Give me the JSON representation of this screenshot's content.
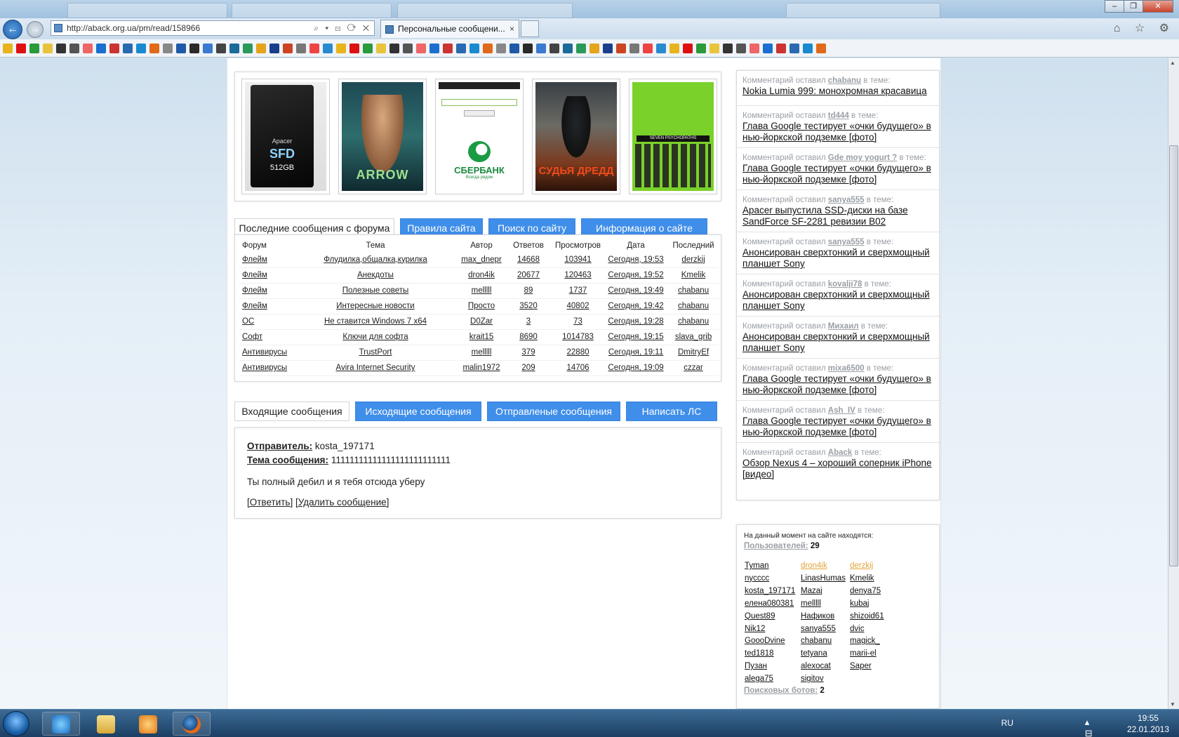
{
  "browser": {
    "url": "http://aback.org.ua/pm/read/158966",
    "tab_title": "Персональные сообщени...",
    "back_label": "←",
    "forward_label": "→",
    "tab_close": "×",
    "addr_tools": "⌕ ▾ ⊡ ⟳ ✕",
    "right_icons": "⌂ ☆ ⚙",
    "window_buttons": {
      "minimize": "–",
      "maximize": "❐",
      "close": "✕"
    }
  },
  "promo_images": [
    {
      "name": "apacer-ssd",
      "brand": "Apacer",
      "model": "SFD",
      "capacity": "512GB"
    },
    {
      "name": "arrow-series",
      "title": "ARROW"
    },
    {
      "name": "sberbank-login",
      "brand": "СБЕРБАНК",
      "slogan": "Всегда рядом"
    },
    {
      "name": "dredd-movie",
      "title": "СУДЬЯ ДРЕДД"
    },
    {
      "name": "seven-psychopaths",
      "title": "SEVEN PSYCHOPATHS"
    }
  ],
  "forum_tabs": {
    "active": "Последние сообщения с форума",
    "rules": "Правила сайта",
    "search": "Поиск по сайту",
    "info": "Информация о сайте"
  },
  "forum_table": {
    "headers": [
      "Форум",
      "Тема",
      "Автор",
      "Ответов",
      "Просмотров",
      "Дата",
      "Последний"
    ],
    "rows": [
      [
        "Флейм",
        "Флудилка,общалка,курилка",
        "max_dnepr",
        "14668",
        "103941",
        "Сегодня, 19:53",
        "derzkij"
      ],
      [
        "Флейм",
        "Анекдоты",
        "dron4ik",
        "20677",
        "120463",
        "Сегодня, 19:52",
        "Kmelik"
      ],
      [
        "Флейм",
        "Полезные советы",
        "melllll",
        "89",
        "1737",
        "Сегодня, 19:49",
        "chabanu"
      ],
      [
        "Флейм",
        "Интересные новости",
        "Просто",
        "3520",
        "40802",
        "Сегодня, 19:42",
        "chabanu"
      ],
      [
        "ОС",
        "Не ставится Windows 7 x64",
        "D0Zar",
        "3",
        "73",
        "Сегодня, 19:28",
        "chabanu"
      ],
      [
        "Софт",
        "Ключи для софта",
        "krait15",
        "8690",
        "1014783",
        "Сегодня, 19:15",
        "slava_grib"
      ],
      [
        "Антивирусы",
        "TrustPort",
        "melllll",
        "379",
        "22880",
        "Сегодня, 19:11",
        "DmitryEf"
      ],
      [
        "Антивирусы",
        "Avira Internet Security",
        "malin1972",
        "209",
        "14706",
        "Сегодня, 19:09",
        "czzar"
      ]
    ]
  },
  "pm_tabs": {
    "inbox": "Входящие сообщения",
    "outbox": "Исходящие сообщения",
    "sent": "Отправленые сообщения",
    "write": "Написать ЛС"
  },
  "message": {
    "sender_label": "Отправитель:",
    "sender": "kosta_197171",
    "subject_label": "Тема сообщения:",
    "subject": "11111111111111111111111111",
    "body": "Ты полный дебил и я тебя отсюда уберу",
    "reply": "[Ответить]",
    "delete": "[Удалить сообщение]"
  },
  "comments": {
    "prefix": "Комментарий оставил",
    "suffix": "в теме:",
    "items": [
      {
        "user": "chabanu",
        "title": "Nokia Lumia 999: монохромная красавица"
      },
      {
        "user": "td444",
        "title": "Глава Google тестирует «очки будущего» в нью-йоркской подземке [фото]"
      },
      {
        "user": "Gde moy yogurt ?",
        "title": "Глава Google тестирует «очки будущего» в нью-йоркской подземке [фото]"
      },
      {
        "user": "sanya555",
        "title": "Apacer выпустила SSD-диски на базе SandForce SF-2281 ревизии B02"
      },
      {
        "user": "sanya555",
        "title": "Анонсирован сверхтонкий и сверхмощный планшет Sony"
      },
      {
        "user": "kovalji78",
        "title": "Анонсирован сверхтонкий и сверхмощный планшет Sony"
      },
      {
        "user": "Михаил",
        "title": "Анонсирован сверхтонкий и сверхмощный планшет Sony"
      },
      {
        "user": "mixa6500",
        "title": "Глава Google тестирует «очки будущего» в нью-йоркской подземке [фото]"
      },
      {
        "user": "Ash_IV",
        "title": "Глава Google тестирует «очки будущего» в нью-йоркской подземке [фото]"
      },
      {
        "user": "Aback",
        "title": "Обзор Nexus 4 – хороший соперник iPhone [видео]"
      }
    ]
  },
  "online": {
    "header": "На данный момент на сайте находятся:",
    "users_label": "Пользователей:",
    "users_count": "29",
    "users": [
      {
        "name": "Tyman",
        "highlight": false
      },
      {
        "name": "dron4ik",
        "highlight": true
      },
      {
        "name": "derzkij",
        "highlight": true
      },
      {
        "name": "nycccc",
        "highlight": false
      },
      {
        "name": "LinasHumas",
        "highlight": false
      },
      {
        "name": "Kmelik",
        "highlight": false
      },
      {
        "name": "kosta_197171",
        "highlight": false
      },
      {
        "name": "Mazaj",
        "highlight": false
      },
      {
        "name": "denya75",
        "highlight": false
      },
      {
        "name": "елена080381",
        "highlight": false
      },
      {
        "name": "melllll",
        "highlight": false
      },
      {
        "name": "kubaj",
        "highlight": false
      },
      {
        "name": "Quest89",
        "highlight": false
      },
      {
        "name": "Нафиков",
        "highlight": false
      },
      {
        "name": "shizoid61",
        "highlight": false
      },
      {
        "name": "Nik12",
        "highlight": false
      },
      {
        "name": "sanya555",
        "highlight": false
      },
      {
        "name": "dvic",
        "highlight": false
      },
      {
        "name": "GoooDvine",
        "highlight": false
      },
      {
        "name": "chabanu",
        "highlight": false
      },
      {
        "name": "magick_",
        "highlight": false
      },
      {
        "name": "ted1818",
        "highlight": false
      },
      {
        "name": "tetyana",
        "highlight": false
      },
      {
        "name": "marii-el",
        "highlight": false
      },
      {
        "name": "Пузан",
        "highlight": false
      },
      {
        "name": "alexocat",
        "highlight": false
      },
      {
        "name": "Saper",
        "highlight": false
      },
      {
        "name": "alega75",
        "highlight": false
      },
      {
        "name": "sigitov",
        "highlight": false
      }
    ],
    "bots_label": "Поисковых ботов:",
    "bots_count": "2"
  },
  "taskbar": {
    "apps": [
      "internet-explorer",
      "file-explorer",
      "media-player",
      "firefox"
    ],
    "language": "RU",
    "tray_icons": "▴ ⊟ ◁)",
    "time": "19:55",
    "date": "22.01.2013"
  },
  "colors": {
    "accent_button": "#3f8eea",
    "meta_gray": "#9a9fa5",
    "online_highlight": "#e3a43a"
  }
}
